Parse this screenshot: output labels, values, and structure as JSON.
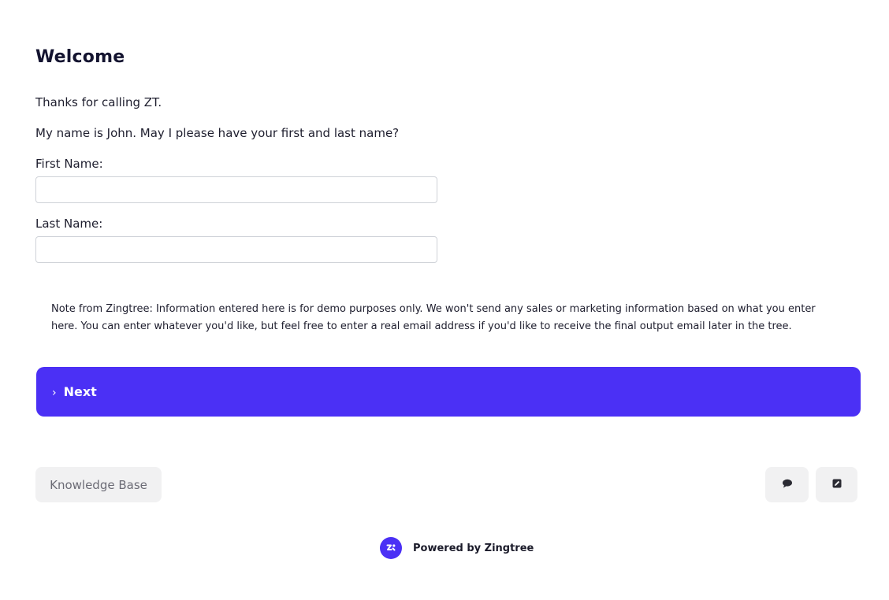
{
  "welcome": {
    "title": "Welcome",
    "intro": "Thanks for calling ZT.",
    "question": "My name is John. May I please have your first and last name?"
  },
  "form": {
    "first_name_label": "First Name:",
    "first_name_value": "",
    "last_name_label": "Last Name:",
    "last_name_value": ""
  },
  "note": "Note from Zingtree: Information entered here is for demo purposes only. We won't send any sales or marketing information based on what you enter here. You can enter whatever you'd like, but feel free to enter a real email address if you'd like to receive the final output email later in the tree.",
  "buttons": {
    "next_label": "Next",
    "knowledge_base_label": "Knowledge Base"
  },
  "icons": {
    "next": "chevron-right-icon",
    "chat": "chat-bubble-icon",
    "edit": "edit-icon",
    "logo": "zingtree-logo-icon"
  },
  "footer": {
    "powered_by": "Powered by Zingtree"
  },
  "colors": {
    "accent": "#4b30f5",
    "button_bg": "#f1f1f2"
  }
}
